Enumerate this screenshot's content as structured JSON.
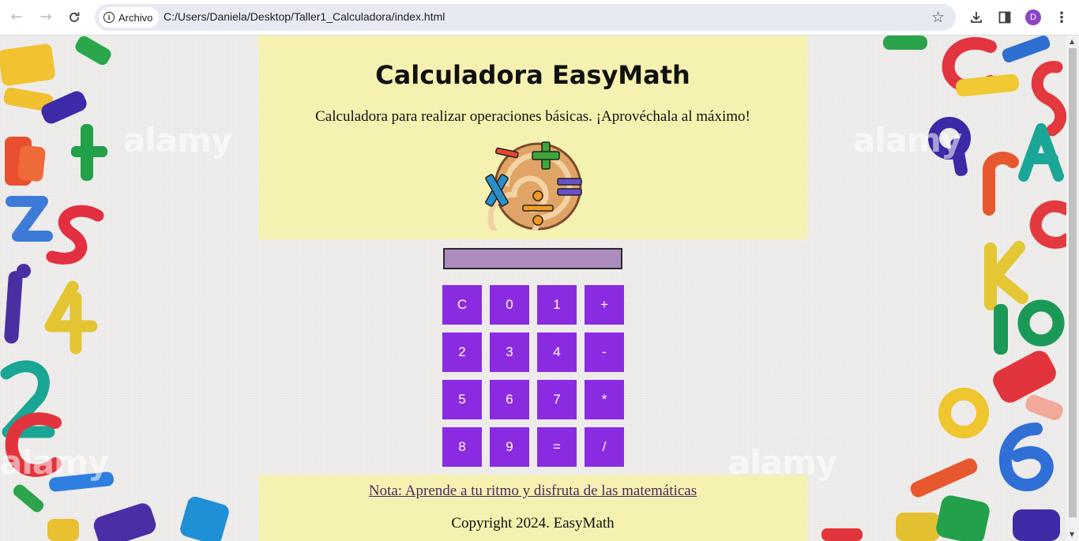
{
  "browser": {
    "security_chip": "Archivo",
    "url": "C:/Users/Daniela/Desktop/Taller1_Calculadora/index.html",
    "profile_initial": "D"
  },
  "header": {
    "title": "Calculadora EasyMath",
    "subtitle": "Calculadora para realizar operaciones básicas. ¡Aprovéchala al máximo!"
  },
  "calculator": {
    "display_value": "",
    "keys": [
      "C",
      "0",
      "1",
      "+",
      "2",
      "3",
      "4",
      "-",
      "5",
      "6",
      "7",
      "*",
      "8",
      "9",
      "=",
      "/"
    ]
  },
  "footer": {
    "note": "Nota: Aprende a tu ritmo y disfruta de las matemáticas",
    "copyright": "Copyright 2024. EasyMath"
  },
  "background": {
    "watermark_text": "alamy"
  },
  "colors": {
    "panel": "#f5f2b1",
    "key": "#8a2be2",
    "display": "#ac8bbd",
    "link": "#4a2a63"
  }
}
